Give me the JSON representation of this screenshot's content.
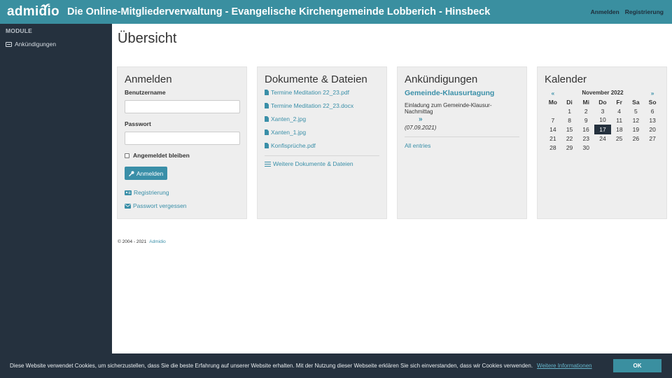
{
  "header": {
    "logo": "admidio",
    "title": "Die Online-Mitgliederverwaltung - Evangelische Kirchengemeinde Lobberich - Hinsbeck",
    "links": [
      "Anmelden",
      "Registrierung"
    ]
  },
  "sidebar": {
    "heading": "MODULE",
    "items": [
      {
        "label": "Ankündigungen",
        "icon": "newspaper-icon"
      }
    ]
  },
  "main": {
    "title": "Übersicht"
  },
  "login": {
    "heading": "Anmelden",
    "username_label": "Benutzername",
    "username_value": "",
    "password_label": "Passwort",
    "password_value": "",
    "remember_label": "Angemeldet bleiben",
    "submit_label": "Anmelden",
    "register_link": "Registrierung",
    "forgot_link": "Passwort vergessen"
  },
  "documents": {
    "heading": "Dokumente & Dateien",
    "files": [
      "Termine Meditation 22_23.pdf",
      "Termine Meditation 22_23.docx",
      "Xanten_2.jpg",
      "Xanten_1.jpg",
      "Konfisprüche.pdf"
    ],
    "more_link": "Weitere Dokumente & Dateien"
  },
  "announcements": {
    "heading": "Ankündigungen",
    "entry_title": "Gemeinde-Klausurtagung",
    "entry_text": "Einladung zum Gemeinde-Klausur-Nachmittag",
    "entry_more": "»",
    "entry_date": "(07.09.2021)",
    "all_link": "All entries"
  },
  "calendar": {
    "heading": "Kalender",
    "prev": "«",
    "next": "»",
    "month": "November 2022",
    "weekdays": [
      "Mo",
      "Di",
      "Mi",
      "Do",
      "Fr",
      "Sa",
      "So"
    ],
    "weeks": [
      [
        "",
        "1",
        "2",
        "3",
        "4",
        "5",
        "6"
      ],
      [
        "7",
        "8",
        "9",
        "10",
        "11",
        "12",
        "13"
      ],
      [
        "14",
        "15",
        "16",
        "17",
        "18",
        "19",
        "20"
      ],
      [
        "21",
        "22",
        "23",
        "24",
        "25",
        "26",
        "27"
      ],
      [
        "28",
        "29",
        "30",
        "",
        "",
        "",
        ""
      ]
    ],
    "today": "17"
  },
  "footer": {
    "copyright": "© 2004 - 2021",
    "link": "Admidio"
  },
  "cookie": {
    "text": "Diese Website verwendet Cookies, um sicherzustellen, dass Sie die beste Erfahrung auf unserer Website erhalten. Mit der Nutzung dieser Webseite erklären Sie sich einverstanden, dass wir Cookies verwenden.",
    "link": "Weitere Informationen",
    "button": "OK"
  },
  "colors": {
    "header": "#3a8fa0",
    "sidebar": "#25313e",
    "accent": "#3a8fa8",
    "card": "#eeeeee"
  }
}
